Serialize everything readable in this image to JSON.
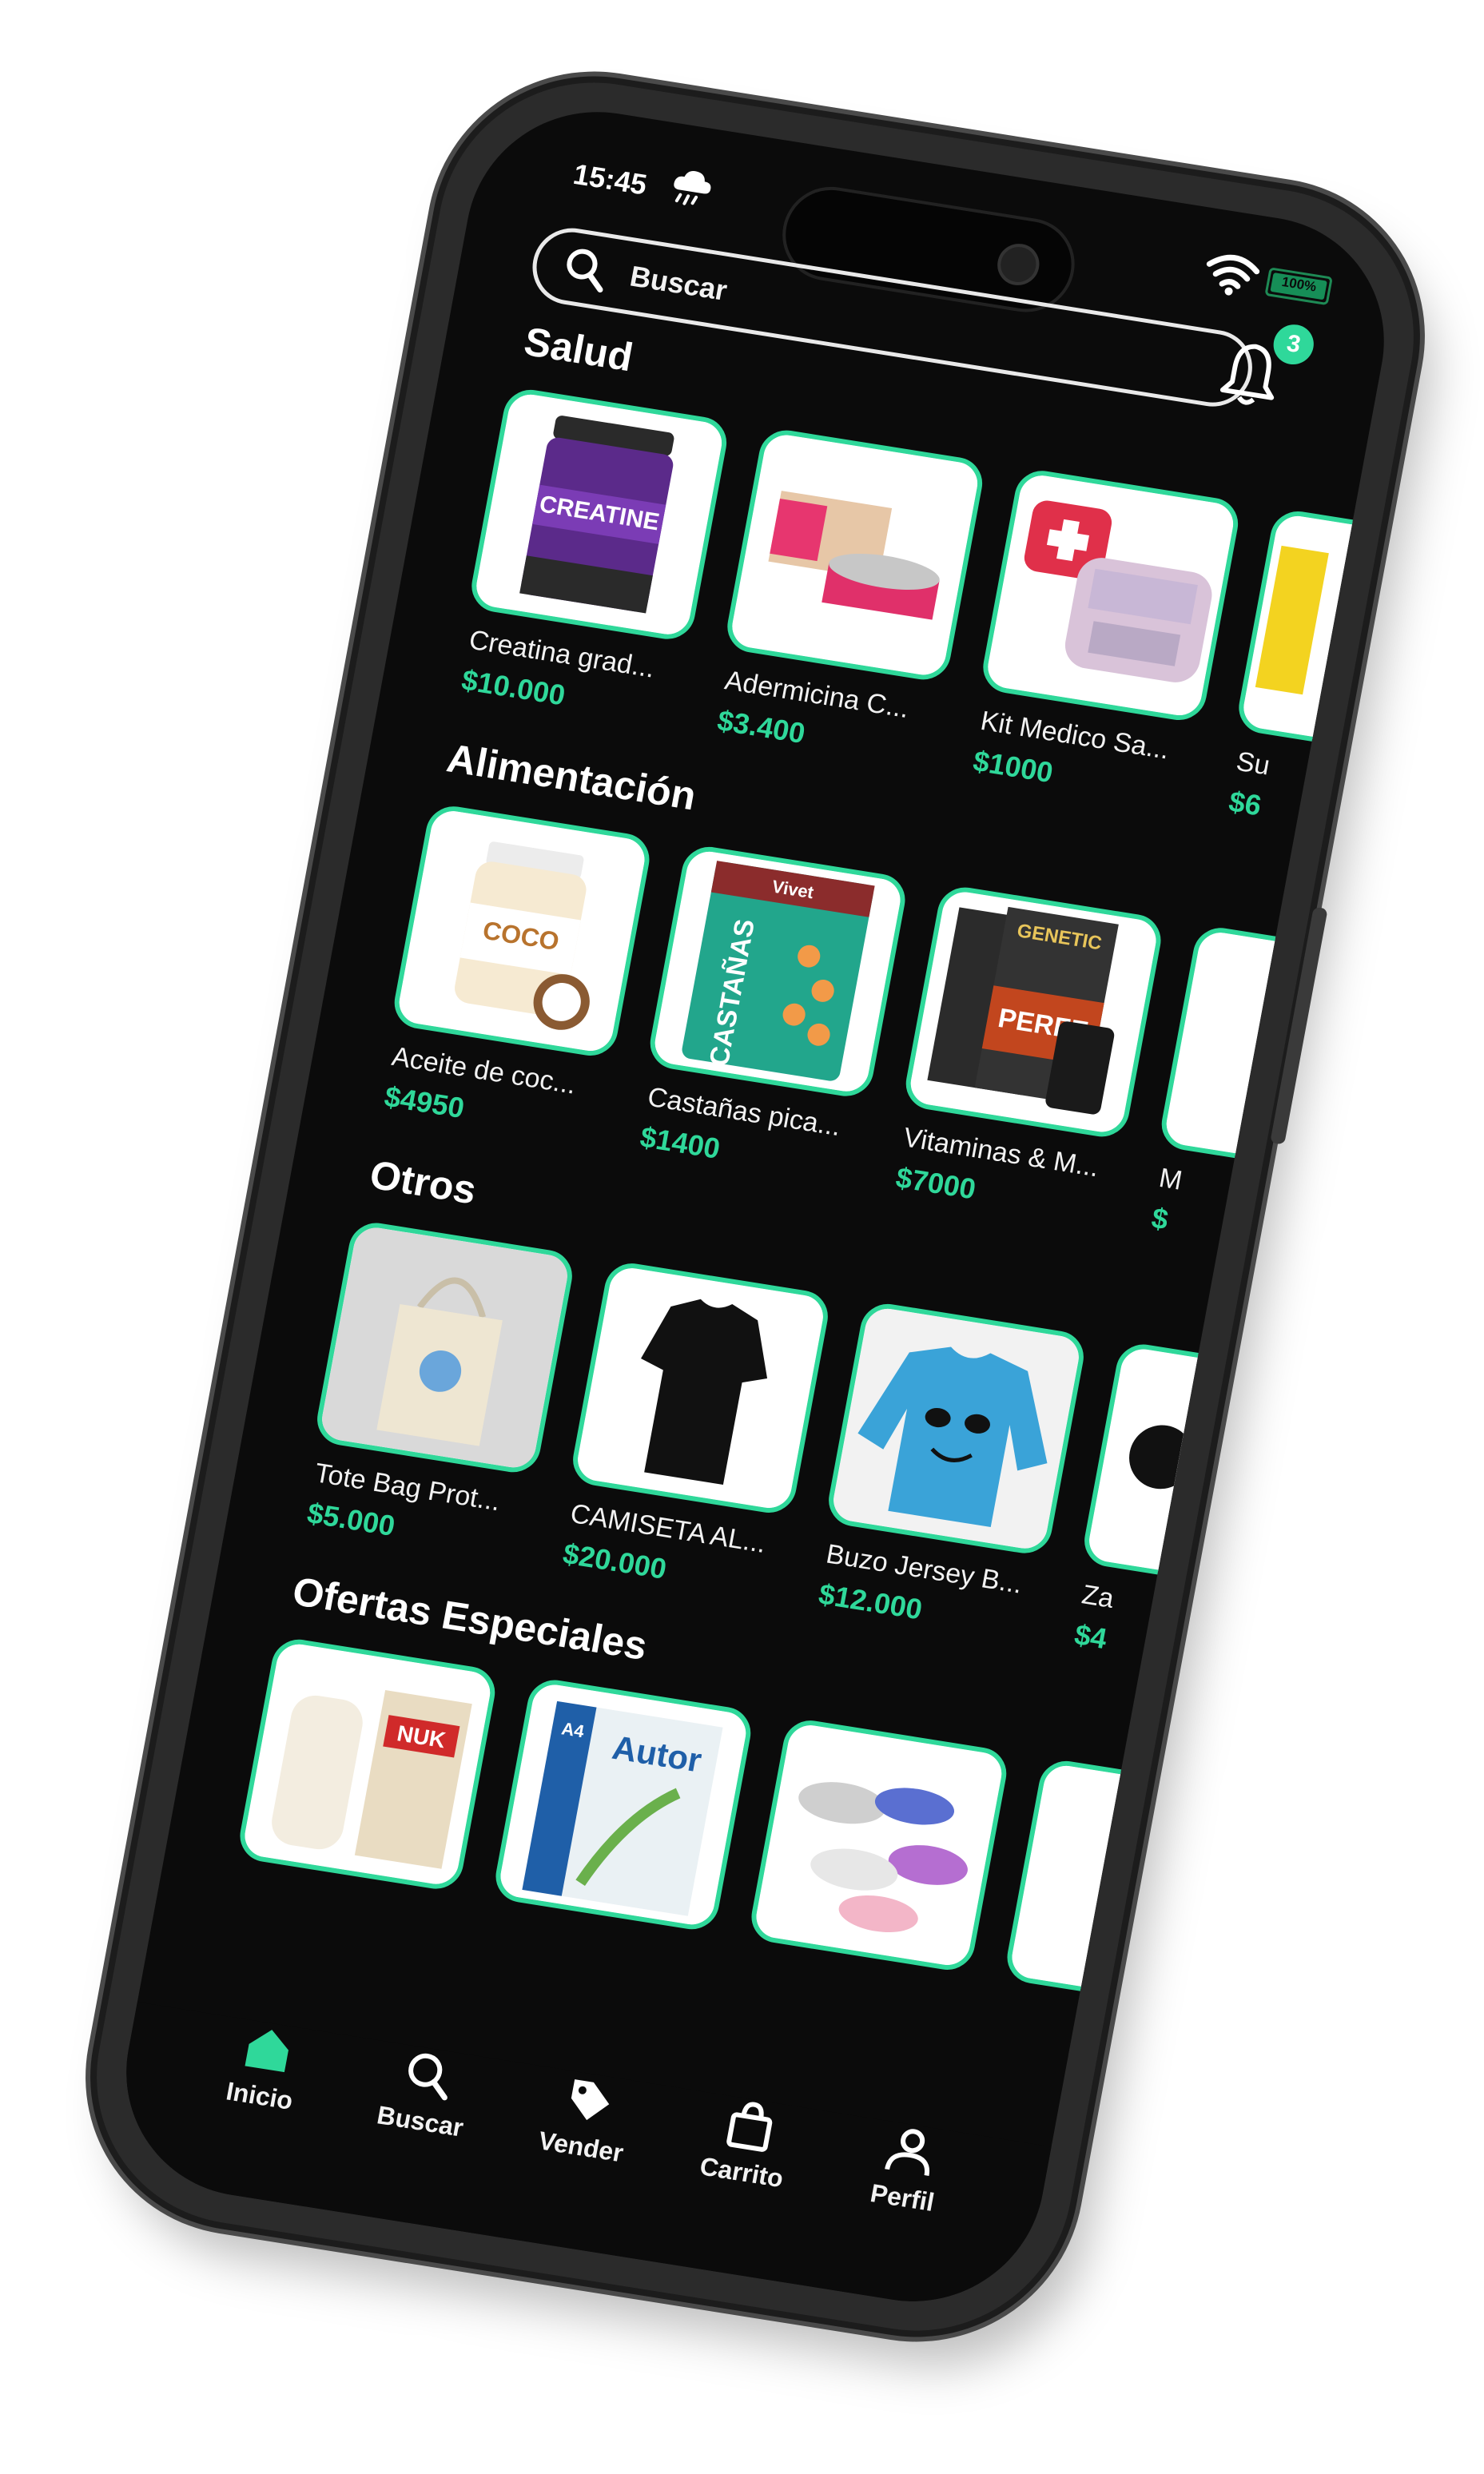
{
  "status": {
    "time": "15:45",
    "battery": "100%",
    "battery_level": 1.0
  },
  "search": {
    "placeholder": "Buscar"
  },
  "notifications": {
    "count": "3"
  },
  "sections": [
    {
      "title": "Salud",
      "items": [
        {
          "name": "Creatina grad...",
          "price": "$10.000"
        },
        {
          "name": "Adermicina C...",
          "price": "$3.400"
        },
        {
          "name": "Kit Medico Sa...",
          "price": "$1000"
        },
        {
          "name": "Su",
          "price": "$6"
        }
      ]
    },
    {
      "title": "Alimentación",
      "items": [
        {
          "name": "Aceite de coc...",
          "price": "$4950"
        },
        {
          "name": "Castañas pica...",
          "price": "$1400"
        },
        {
          "name": "Vitaminas & M...",
          "price": "$7000"
        },
        {
          "name": "M",
          "price": "$"
        }
      ]
    },
    {
      "title": "Otros",
      "items": [
        {
          "name": "Tote Bag Prot...",
          "price": "$5.000"
        },
        {
          "name": "CAMISETA AL...",
          "price": "$20.000"
        },
        {
          "name": "Buzo Jersey B...",
          "price": "$12.000"
        },
        {
          "name": "Za",
          "price": "$4"
        }
      ]
    },
    {
      "title": "Ofertas Especiales",
      "items": [
        {
          "name": "",
          "price": ""
        },
        {
          "name": "",
          "price": ""
        },
        {
          "name": "",
          "price": ""
        },
        {
          "name": "",
          "price": ""
        }
      ]
    }
  ],
  "product_image_text": {
    "creatine": "CREATINE",
    "coco": "COCO",
    "castanas": "CASTAÑAS",
    "vivet": "Vivet",
    "genetic": "GENETIC",
    "perfe": "PERFE",
    "nuk": "NUK",
    "autor": "Autor",
    "a4": "A4"
  },
  "bottom_nav": [
    {
      "label": "Inicio",
      "icon": "home-icon",
      "active": true
    },
    {
      "label": "Buscar",
      "icon": "search-icon",
      "active": false
    },
    {
      "label": "Vender",
      "icon": "tag-icon",
      "active": false
    },
    {
      "label": "Carrito",
      "icon": "shopping-bag-icon",
      "active": false
    },
    {
      "label": "Perfil",
      "icon": "user-icon",
      "active": false
    }
  ],
  "colors": {
    "accent": "#2fd89a",
    "background": "#0b0b0b",
    "text": "#f2f2f2"
  }
}
